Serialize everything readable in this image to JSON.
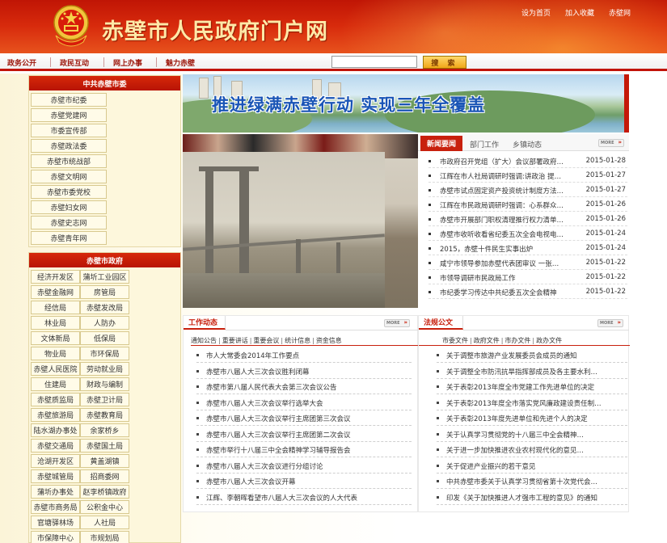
{
  "header": {
    "site_title": "赤壁市人民政府门户网",
    "top_links": [
      "设为首页",
      "加入收藏",
      "赤壁网"
    ]
  },
  "nav": {
    "items": [
      "政务公开",
      "政民互动",
      "网上办事",
      "魅力赤壁"
    ],
    "search_placeholder": "",
    "search_button": "搜 索"
  },
  "left": {
    "party_title": "中共赤壁市委",
    "party_items": [
      "赤壁市纪委",
      "赤壁党建网",
      "市委宣传部",
      "赤壁政法委",
      "赤壁市统战部",
      "赤壁文明网",
      "赤壁市委党校",
      "赤壁妇女网",
      "赤壁史志网",
      "赤壁青年网"
    ],
    "gov_title": "赤壁市政府",
    "gov_items": [
      [
        "经济开发区",
        "蒲圻工业园区"
      ],
      [
        "赤壁金融网",
        "房管局"
      ],
      [
        "经信局",
        "赤壁发改局"
      ],
      [
        "林业局",
        "人防办"
      ],
      [
        "文体新局",
        "低保局"
      ],
      [
        "物业局",
        "市环保局"
      ],
      [
        "赤壁人民医院",
        "劳动就业局"
      ],
      [
        "住建局",
        "财政与编制"
      ],
      [
        "赤壁质监局",
        "赤壁卫计局"
      ],
      [
        "赤壁旅游局",
        "赤壁教育局"
      ],
      [
        "陆水湖办事处",
        "余家桥乡"
      ],
      [
        "赤壁交通局",
        "赤壁国土局"
      ],
      [
        "沧湖开发区",
        "黄盖湖镇"
      ],
      [
        "赤壁城管局",
        "招商委网"
      ],
      [
        "蒲圻办事处",
        "赵李桥镇政府"
      ],
      [
        "赤壁市商务局",
        "公积金中心"
      ],
      [
        "官塘驿林场",
        "人社局"
      ],
      [
        "市保障中心",
        "市规划局"
      ]
    ]
  },
  "banner": {
    "text": "推进绿满赤壁行动  实现三年全覆盖"
  },
  "news": {
    "tabs": [
      "新闻要闻",
      "部门工作",
      "乡镇动态"
    ],
    "more": "MORE",
    "items": [
      {
        "title": "市政府召开党组（扩大）会议部署政府…",
        "date": "2015-01-28"
      },
      {
        "title": "江辉在市人社局调研时强调:讲政治 提…",
        "date": "2015-01-27"
      },
      {
        "title": "赤壁市试点固定资产投资统计制度方法…",
        "date": "2015-01-27"
      },
      {
        "title": "江辉在市民政局调研时强调：心系群众…",
        "date": "2015-01-26"
      },
      {
        "title": "赤壁市开展部门职权清理推行权力清单…",
        "date": "2015-01-26"
      },
      {
        "title": "赤壁市收听收看省纪委五次全会电视电…",
        "date": "2015-01-24"
      },
      {
        "title": "2015，赤壁十件民生实事出炉",
        "date": "2015-01-24"
      },
      {
        "title": "咸宁市领导参加赤壁代表团审议 一张…",
        "date": "2015-01-22"
      },
      {
        "title": "市领导调研市民政局工作",
        "date": "2015-01-22"
      },
      {
        "title": "市纪委学习传达中共纪委五次全会精神",
        "date": "2015-01-22"
      }
    ]
  },
  "work": {
    "title": "工作动态",
    "more": "MORE",
    "links": [
      "通知公告",
      "重要讲话",
      "重要会议",
      "统计信息",
      "资金信息"
    ],
    "items": [
      "市人大常委会2014年工作要点",
      "赤壁市八届人大三次会议胜利闭幕",
      "赤壁市第八届人民代表大会第三次会议公告",
      "赤壁市八届人大三次会议举行选举大会",
      "赤壁市八届人大三次会议举行主席团第三次会议",
      "赤壁市八届人大三次会议举行主席团第二次会议",
      "赤壁市举行十八届三中全会精神学习辅导报告会",
      "赤壁市八届人大三次会议进行分组讨论",
      "赤壁市八届人大三次会议开幕",
      "江辉、李朝晖看望市八届人大三次会议的人大代表"
    ]
  },
  "law": {
    "title": "法规公文",
    "more": "MORE",
    "links": [
      "市委文件",
      "政府文件",
      "市办文件",
      "政办文件"
    ],
    "items": [
      "关于调整市旅游产业发展委员会成员的通知",
      "关于调整全市防汛抗旱指挥部成员及各主要水利…",
      "关于表彰2013年度全市党建工作先进单位的决定",
      "关于表彰2013年度全市落实党风廉政建设责任制…",
      "关于表彰2013年度先进单位和先进个人的决定",
      "关于认真学习贯彻党的十八届三中全会精神…",
      "关于进一步加快推进农业农村现代化的意见…",
      "关于促进产业振兴的若干意见",
      "中共赤壁市委关于认真学习贯彻省第十次党代会…",
      "印发《关于加快推进人才强市工程的意见》的通知"
    ]
  }
}
